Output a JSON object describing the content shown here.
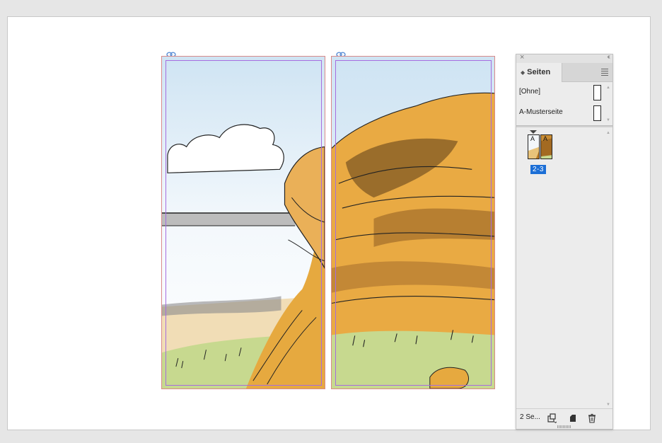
{
  "document": {
    "spread_pages": [
      "page-2",
      "page-3"
    ]
  },
  "pages_panel": {
    "tab_label": "Seiten",
    "close_glyph": "×",
    "collapse_glyph": "‹‹",
    "masters": [
      {
        "label": "[Ohne]"
      },
      {
        "label": "A-Musterseite"
      }
    ],
    "spread": {
      "label": "2-3",
      "left_prefix": "A",
      "right_prefix": "A"
    },
    "page_count_label": "2 Se...",
    "icons": [
      "panel-menu-icon",
      "edit-page-size-icon",
      "new-page-icon",
      "delete-page-icon"
    ]
  },
  "colors": {
    "accent": "#1c6fd6",
    "page_frame": "#d98a8a",
    "margin_guide": "#a66de0",
    "rock": "#e6a93f",
    "sky": "#d8e9f5",
    "grass": "#c7d98f"
  }
}
